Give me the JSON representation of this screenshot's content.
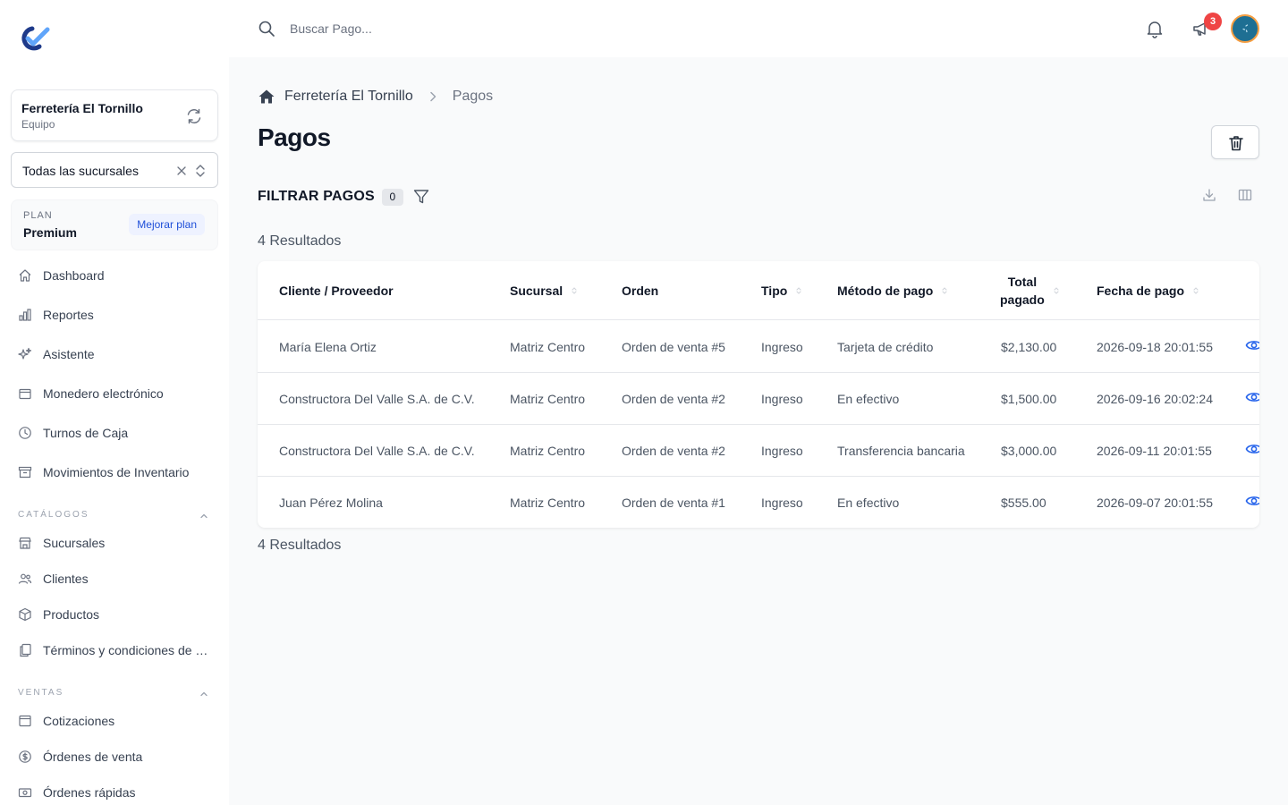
{
  "app": {
    "accent": "#2563eb"
  },
  "sidebar": {
    "team": {
      "name": "Ferretería El Tornillo",
      "role": "Equipo"
    },
    "branch_select": {
      "value": "Todas las sucursales"
    },
    "plan": {
      "label": "PLAN",
      "value": "Premium",
      "upgrade_label": "Mejorar plan"
    },
    "items": [
      {
        "label": "Dashboard",
        "icon": "home-icon"
      },
      {
        "label": "Reportes",
        "icon": "chart-icon"
      },
      {
        "label": "Asistente",
        "icon": "sparkles-icon"
      },
      {
        "label": "Monedero electrónico",
        "icon": "wallet-icon"
      },
      {
        "label": "Turnos de Caja",
        "icon": "clock-icon"
      },
      {
        "label": "Movimientos de Inventario",
        "icon": "archive-icon"
      }
    ],
    "catalogos": {
      "title": "CATÁLOGOS",
      "items": [
        {
          "label": "Sucursales",
          "icon": "store-icon"
        },
        {
          "label": "Clientes",
          "icon": "users-icon"
        },
        {
          "label": "Productos",
          "icon": "cube-icon"
        },
        {
          "label": "Términos y condiciones de ventas",
          "icon": "documents-icon"
        }
      ]
    },
    "ventas": {
      "title": "VENTAS",
      "items": [
        {
          "label": "Cotizaciones",
          "icon": "document-icon"
        },
        {
          "label": "Órdenes de venta",
          "icon": "dollar-icon"
        },
        {
          "label": "Órdenes rápidas",
          "icon": "cash-icon"
        }
      ]
    }
  },
  "topbar": {
    "search_placeholder": "Buscar Pago...",
    "notification_count": "3"
  },
  "breadcrumb": {
    "home": "Ferretería El Tornillo",
    "current": "Pagos"
  },
  "page": {
    "title": "Pagos"
  },
  "filters": {
    "title": "FILTRAR PAGOS",
    "count": "0"
  },
  "results_label": "4 Resultados",
  "table": {
    "headers": {
      "cliente": "Cliente / Proveedor",
      "sucursal": "Sucursal",
      "orden": "Orden",
      "tipo": "Tipo",
      "metodo": "Método de pago",
      "total_line1": "Total",
      "total_line2": "pagado",
      "fecha": "Fecha de pago"
    },
    "rows": [
      {
        "cliente": "María Elena Ortiz",
        "sucursal": "Matriz Centro",
        "orden": "Orden de venta #5",
        "tipo": "Ingreso",
        "metodo": "Tarjeta de crédito",
        "total": "$2,130.00",
        "fecha": "2026-09-18 20:01:55"
      },
      {
        "cliente": "Constructora Del Valle S.A. de C.V.",
        "sucursal": "Matriz Centro",
        "orden": "Orden de venta #2",
        "tipo": "Ingreso",
        "metodo": "En efectivo",
        "total": "$1,500.00",
        "fecha": "2026-09-16 20:02:24"
      },
      {
        "cliente": "Constructora Del Valle S.A. de C.V.",
        "sucursal": "Matriz Centro",
        "orden": "Orden de venta #2",
        "tipo": "Ingreso",
        "metodo": "Transferencia bancaria",
        "total": "$3,000.00",
        "fecha": "2026-09-11 20:01:55"
      },
      {
        "cliente": "Juan Pérez Molina",
        "sucursal": "Matriz Centro",
        "orden": "Orden de venta #1",
        "tipo": "Ingreso",
        "metodo": "En efectivo",
        "total": "$555.00",
        "fecha": "2026-09-07 20:01:55"
      }
    ]
  }
}
